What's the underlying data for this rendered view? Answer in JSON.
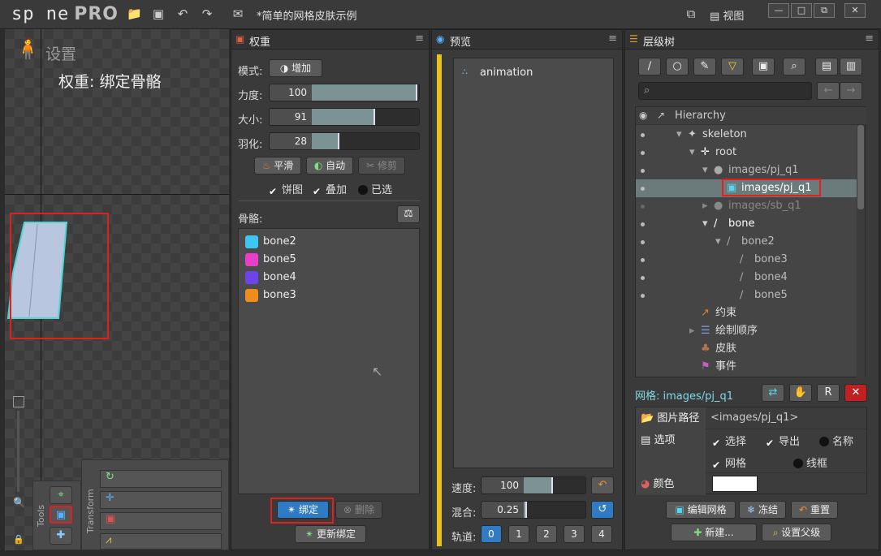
{
  "app": {
    "logo_main": "sp ne",
    "logo_pro": "PRO",
    "doc_title": "*简单的网格皮肤示例",
    "view_menu": "视图"
  },
  "viewport": {
    "title": "设置",
    "mode_label": "权重: 绑定骨骼",
    "tools_label": "Tools",
    "transform_label": "Transform"
  },
  "weights": {
    "title": "权重",
    "mode_label": "模式:",
    "mode_value": "增加",
    "strength_label": "力度:",
    "strength": 100,
    "size_label": "大小:",
    "size": 91,
    "feather_label": "羽化:",
    "feather": 28,
    "smooth": "平滑",
    "auto": "自动",
    "prune": "修剪",
    "pie": "饼图",
    "overlay": "叠加",
    "selected": "已选",
    "bones_label": "骨骼:",
    "bones": [
      {
        "name": "bone2",
        "color": "#3ec6ef"
      },
      {
        "name": "bone5",
        "color": "#e83fc9"
      },
      {
        "name": "bone4",
        "color": "#6b45e8"
      },
      {
        "name": "bone3",
        "color": "#f08b1d"
      }
    ],
    "bind": "绑定",
    "delete": "删除",
    "update_bind": "更新绑定"
  },
  "preview": {
    "title": "预览",
    "animation": "animation",
    "speed_label": "速度:",
    "speed": 100,
    "mix_label": "混合:",
    "mix": 0.25,
    "track_label": "轨道:",
    "tracks": [
      "0",
      "1",
      "2",
      "3",
      "4"
    ]
  },
  "tree": {
    "title": "层级树",
    "header": "Hierarchy",
    "rows": [
      {
        "label": "skeleton"
      },
      {
        "label": "root"
      },
      {
        "label": "images/pj_q1"
      },
      {
        "label": "images/pj_q1"
      },
      {
        "label": "images/sb_q1"
      },
      {
        "label": "bone"
      },
      {
        "label": "bone2"
      },
      {
        "label": "bone3"
      },
      {
        "label": "bone4"
      },
      {
        "label": "bone5"
      },
      {
        "label": "约束"
      },
      {
        "label": "绘制顺序"
      },
      {
        "label": "皮肤"
      },
      {
        "label": "事件"
      }
    ],
    "mesh_label": "网格: images/pj_q1",
    "path_key": "图片路径",
    "path_value": "<images/pj_q1>",
    "options_key": "选项",
    "opt_select": "选择",
    "opt_export": "导出",
    "opt_name": "名称",
    "opt_mesh": "网格",
    "opt_wire": "线框",
    "color_key": "颜色",
    "edit_mesh": "编辑网格",
    "freeze": "冻结",
    "reset": "重置",
    "new": "新建...",
    "set_parent": "设置父级"
  }
}
